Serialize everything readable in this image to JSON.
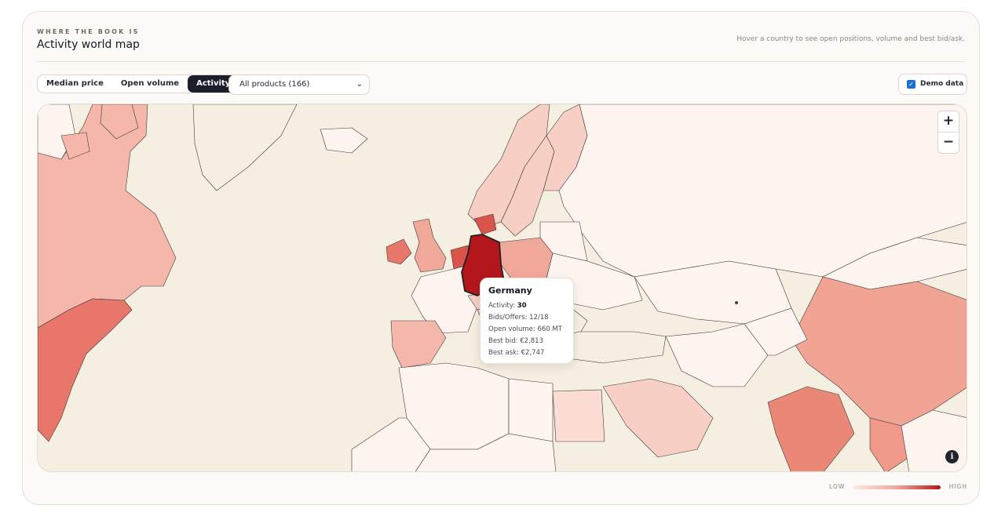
{
  "header": {
    "eyebrow": "WHERE THE BOOK IS",
    "title": "Activity world map",
    "hint": "Hover a country to see open positions, volume and best bid/ask."
  },
  "toolbar": {
    "tabs": [
      {
        "label": "Median price",
        "active": false
      },
      {
        "label": "Open volume",
        "active": false
      },
      {
        "label": "Activity",
        "active": true
      }
    ],
    "product_select": "All products (166)",
    "demo_label": "Demo data",
    "demo_checked": true
  },
  "map": {
    "icons": {
      "zoom_in": "+",
      "zoom_out": "−",
      "info": "i"
    },
    "colors": {
      "ocean": "#f5efe2",
      "no_data": "#fdf3ef",
      "low": "#fbe9e4",
      "high": "#b3171c",
      "border": "#2b2b2b"
    },
    "hovered_country": "Germany",
    "tooltip": {
      "name": "Germany",
      "activity_label": "Activity:",
      "activity_value": "30",
      "bids_offers": "Bids/Offers: 12/18",
      "open_volume": "Open volume: 660 MT",
      "best_bid": "Best bid: €2,813",
      "best_ask": "Best ask: €2,747"
    }
  },
  "legend": {
    "low": "LOW",
    "high": "HIGH"
  }
}
